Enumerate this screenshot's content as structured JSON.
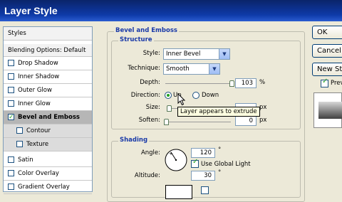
{
  "window": {
    "title": "Layer Style"
  },
  "styles_panel": {
    "header": "Styles",
    "blending": "Blending Options: Default",
    "items": [
      {
        "label": "Drop Shadow",
        "checked": false
      },
      {
        "label": "Inner Shadow",
        "checked": false
      },
      {
        "label": "Outer Glow",
        "checked": false
      },
      {
        "label": "Inner Glow",
        "checked": false
      },
      {
        "label": "Bevel and Emboss",
        "checked": true,
        "selected": true
      },
      {
        "label": "Contour",
        "checked": false,
        "sub": true
      },
      {
        "label": "Texture",
        "checked": false,
        "sub": true
      },
      {
        "label": "Satin",
        "checked": false
      },
      {
        "label": "Color Overlay",
        "checked": false
      },
      {
        "label": "Gradient Overlay",
        "checked": false
      }
    ]
  },
  "bevel": {
    "title": "Bevel and Emboss",
    "structure": {
      "title": "Structure",
      "style_label": "Style:",
      "style_value": "Inner Bevel",
      "technique_label": "Technique:",
      "technique_value": "Smooth",
      "depth_label": "Depth:",
      "depth_value": "103",
      "depth_unit": "%",
      "direction_label": "Direction:",
      "direction_up": "Up",
      "direction_down": "Down",
      "size_label": "Size:",
      "size_unit": "px",
      "soften_label": "Soften:",
      "soften_value": "0",
      "soften_unit": "px",
      "tooltip": "Layer appears to extrude"
    },
    "shading": {
      "title": "Shading",
      "angle_label": "Angle:",
      "angle_value": "120",
      "angle_unit": "°",
      "global_light_label": "Use Global Light",
      "altitude_label": "Altitude:",
      "altitude_value": "30",
      "altitude_unit": "°"
    }
  },
  "buttons": {
    "ok": "OK",
    "cancel": "Cancel",
    "new_style": "New Style...",
    "preview": "Preview"
  }
}
